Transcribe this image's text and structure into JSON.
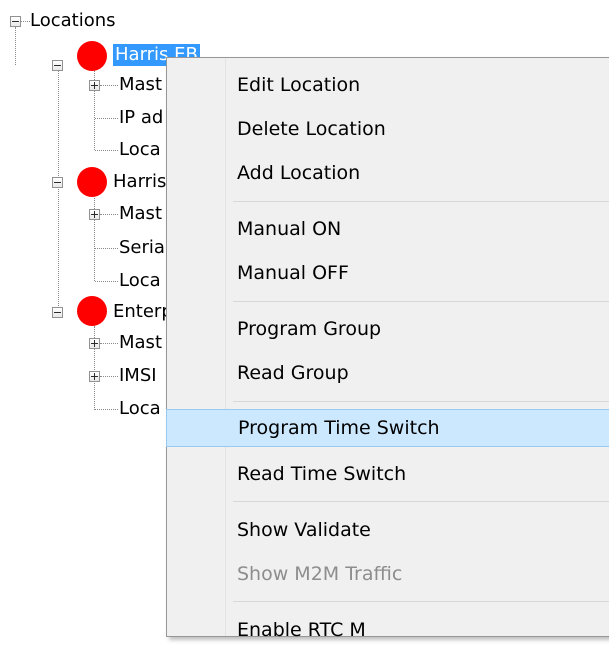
{
  "tree": {
    "root_label": "Locations",
    "groups": [
      {
        "label": "Harris EB",
        "children": [
          "Mast",
          "IP ad",
          "Loca"
        ]
      },
      {
        "label": "Harris",
        "children": [
          "Mast",
          "Seria",
          "Loca"
        ]
      },
      {
        "label": "Enterp",
        "children": [
          "Mast",
          "IMSI",
          "Loca"
        ]
      }
    ]
  },
  "context_menu": {
    "items": {
      "edit_location": "Edit Location",
      "delete_location": "Delete Location",
      "add_location": "Add Location",
      "manual_on": "Manual ON",
      "manual_off": "Manual OFF",
      "program_group": "Program Group",
      "read_group": "Read Group",
      "program_time_switch": "Program Time Switch",
      "read_time_switch": "Read Time Switch",
      "show_validate": "Show Validate",
      "show_m2m_traffic": "Show M2M Traffic",
      "enable_rtc_m": "Enable RTC M"
    },
    "hovered_item": "Program Time Switch",
    "disabled_item": "Show M2M Traffic"
  },
  "colors": {
    "status_dot": "#ff0000",
    "selection": "#3399ff",
    "hover": "#cce8ff",
    "menu_bg": "#f0f0f0"
  }
}
